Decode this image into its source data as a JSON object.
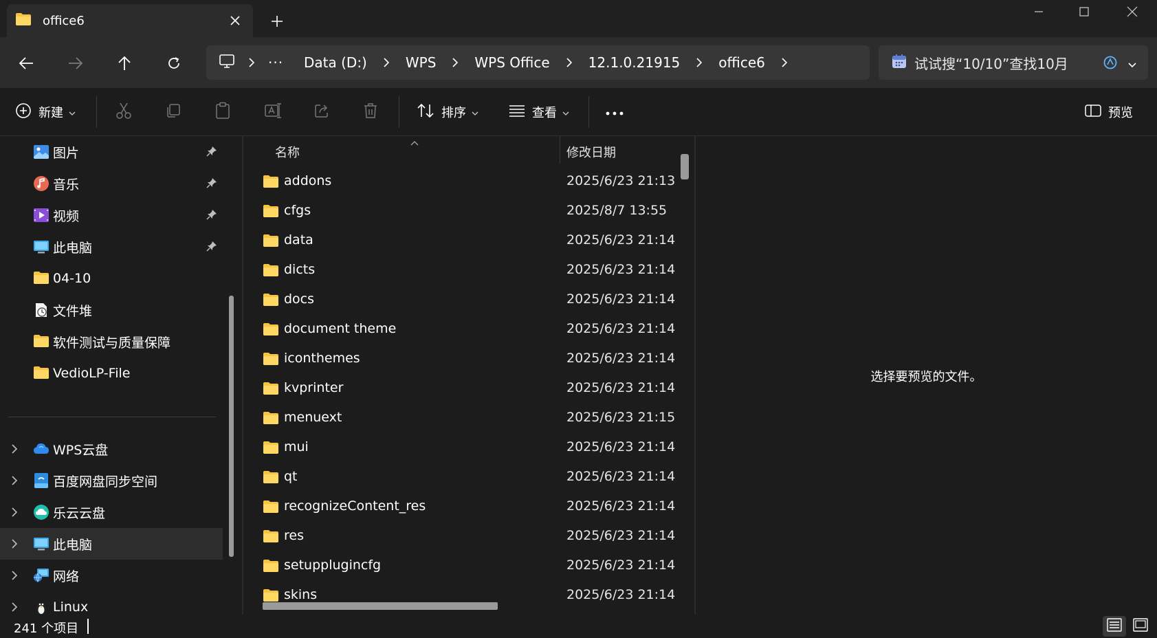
{
  "tab": {
    "title": "office6"
  },
  "address": {
    "crumbs": [
      "Data (D:)",
      "WPS",
      "WPS Office",
      "12.1.0.21915",
      "office6"
    ]
  },
  "search": {
    "placeholder": "试试搜“10/10”查找10月"
  },
  "commands": {
    "new_label": "新建",
    "sort_label": "排序",
    "view_label": "查看",
    "preview_label": "预览"
  },
  "sidebar": {
    "quick_access": [
      {
        "label": "图片",
        "icon": "pictures-icon",
        "pinned": true
      },
      {
        "label": "音乐",
        "icon": "music-icon",
        "pinned": true
      },
      {
        "label": "视频",
        "icon": "video-icon",
        "pinned": true
      },
      {
        "label": "此电脑",
        "icon": "computer-icon",
        "pinned": true
      },
      {
        "label": "04-10",
        "icon": "folder-icon",
        "pinned": false
      },
      {
        "label": "文件堆",
        "icon": "file-pile-icon",
        "pinned": false
      },
      {
        "label": "软件测试与质量保障",
        "icon": "folder-icon",
        "pinned": false
      },
      {
        "label": "VedioLP-File",
        "icon": "folder-icon",
        "pinned": false
      }
    ],
    "locations": [
      {
        "label": "WPS云盘",
        "icon": "wps-cloud-icon"
      },
      {
        "label": "百度网盘同步空间",
        "icon": "baidu-netdisk-icon"
      },
      {
        "label": "乐云云盘",
        "icon": "leyun-cloud-icon"
      },
      {
        "label": "此电脑",
        "icon": "computer-icon",
        "selected": true
      },
      {
        "label": "网络",
        "icon": "network-icon"
      },
      {
        "label": "Linux",
        "icon": "linux-icon"
      }
    ]
  },
  "filelist": {
    "columns": {
      "name": "名称",
      "modified": "修改日期"
    },
    "rows": [
      {
        "name": "addons",
        "date": "2025/6/23 21:13"
      },
      {
        "name": "cfgs",
        "date": "2025/8/7 13:55"
      },
      {
        "name": "data",
        "date": "2025/6/23 21:14"
      },
      {
        "name": "dicts",
        "date": "2025/6/23 21:14"
      },
      {
        "name": "docs",
        "date": "2025/6/23 21:14"
      },
      {
        "name": "document theme",
        "date": "2025/6/23 21:14"
      },
      {
        "name": "iconthemes",
        "date": "2025/6/23 21:14"
      },
      {
        "name": "kvprinter",
        "date": "2025/6/23 21:14"
      },
      {
        "name": "menuext",
        "date": "2025/6/23 21:15"
      },
      {
        "name": "mui",
        "date": "2025/6/23 21:14"
      },
      {
        "name": "qt",
        "date": "2025/6/23 21:14"
      },
      {
        "name": "recognizeContent_res",
        "date": "2025/6/23 21:14"
      },
      {
        "name": "res",
        "date": "2025/6/23 21:14"
      },
      {
        "name": "setupplugincfg",
        "date": "2025/6/23 21:14"
      },
      {
        "name": "skins",
        "date": "2025/6/23 21:14"
      }
    ]
  },
  "preview": {
    "message": "选择要预览的文件。"
  },
  "status": {
    "count": "241 个项目"
  },
  "colors": {
    "folder": "#f5c542",
    "background": "#1c1c1c",
    "toolbar": "#2c2c2c"
  }
}
